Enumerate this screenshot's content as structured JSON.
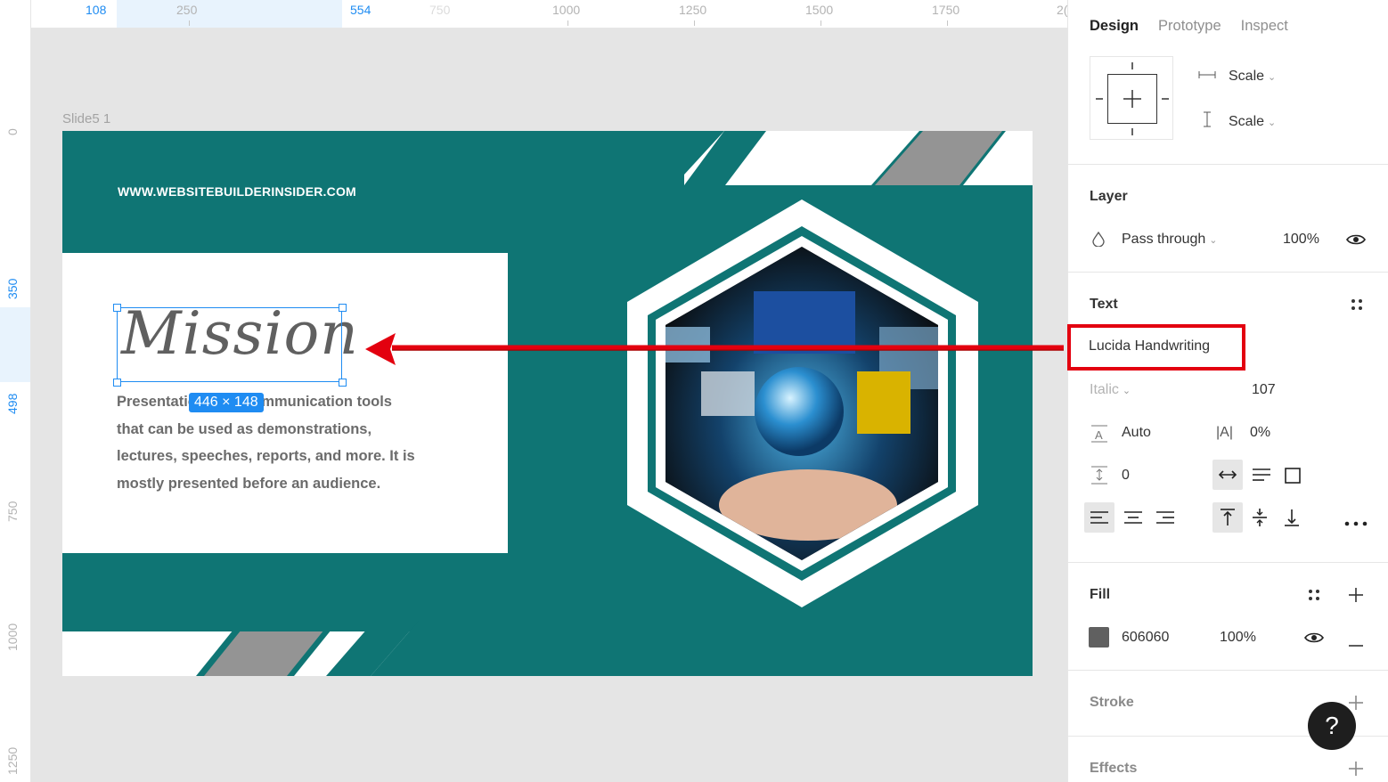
{
  "ruler": {
    "top_labels": [
      "108",
      "250",
      "554",
      "750",
      "1000",
      "1250",
      "1500",
      "1750",
      "2("
    ],
    "left_labels": [
      "0",
      "350",
      "498",
      "750",
      "1000",
      "1250"
    ]
  },
  "canvas": {
    "frame_label": "Slide5 1",
    "site_url": "WWW.WEBSITEBUILDERINSIDER.COM",
    "heading": "Mission",
    "body_text": "Presentations are communication tools that can be used as demonstrations, lectures, speeches, reports, and more. It is mostly presented before an audience.",
    "selection_size": "446 × 148",
    "slide_color": "#0f7574"
  },
  "panel": {
    "tabs": [
      {
        "label": "Design",
        "active": true
      },
      {
        "label": "Prototype",
        "active": false
      },
      {
        "label": "Inspect",
        "active": false
      }
    ],
    "constraints": {
      "horizontal": "Scale",
      "vertical": "Scale"
    },
    "layer": {
      "title": "Layer",
      "blend_mode": "Pass through",
      "opacity": "100%"
    },
    "text": {
      "title": "Text",
      "font_family": "Lucida Handwriting",
      "font_style": "Italic",
      "font_size": "107",
      "line_height": "Auto",
      "letter_spacing": "0%",
      "paragraph_spacing": "0"
    },
    "fill": {
      "title": "Fill",
      "hex": "606060",
      "opacity": "100%",
      "color": "#606060"
    },
    "stroke": {
      "title": "Stroke"
    },
    "effects": {
      "title": "Effects"
    },
    "help": "?"
  },
  "annotation": {
    "highlight_color": "#e3000f"
  }
}
